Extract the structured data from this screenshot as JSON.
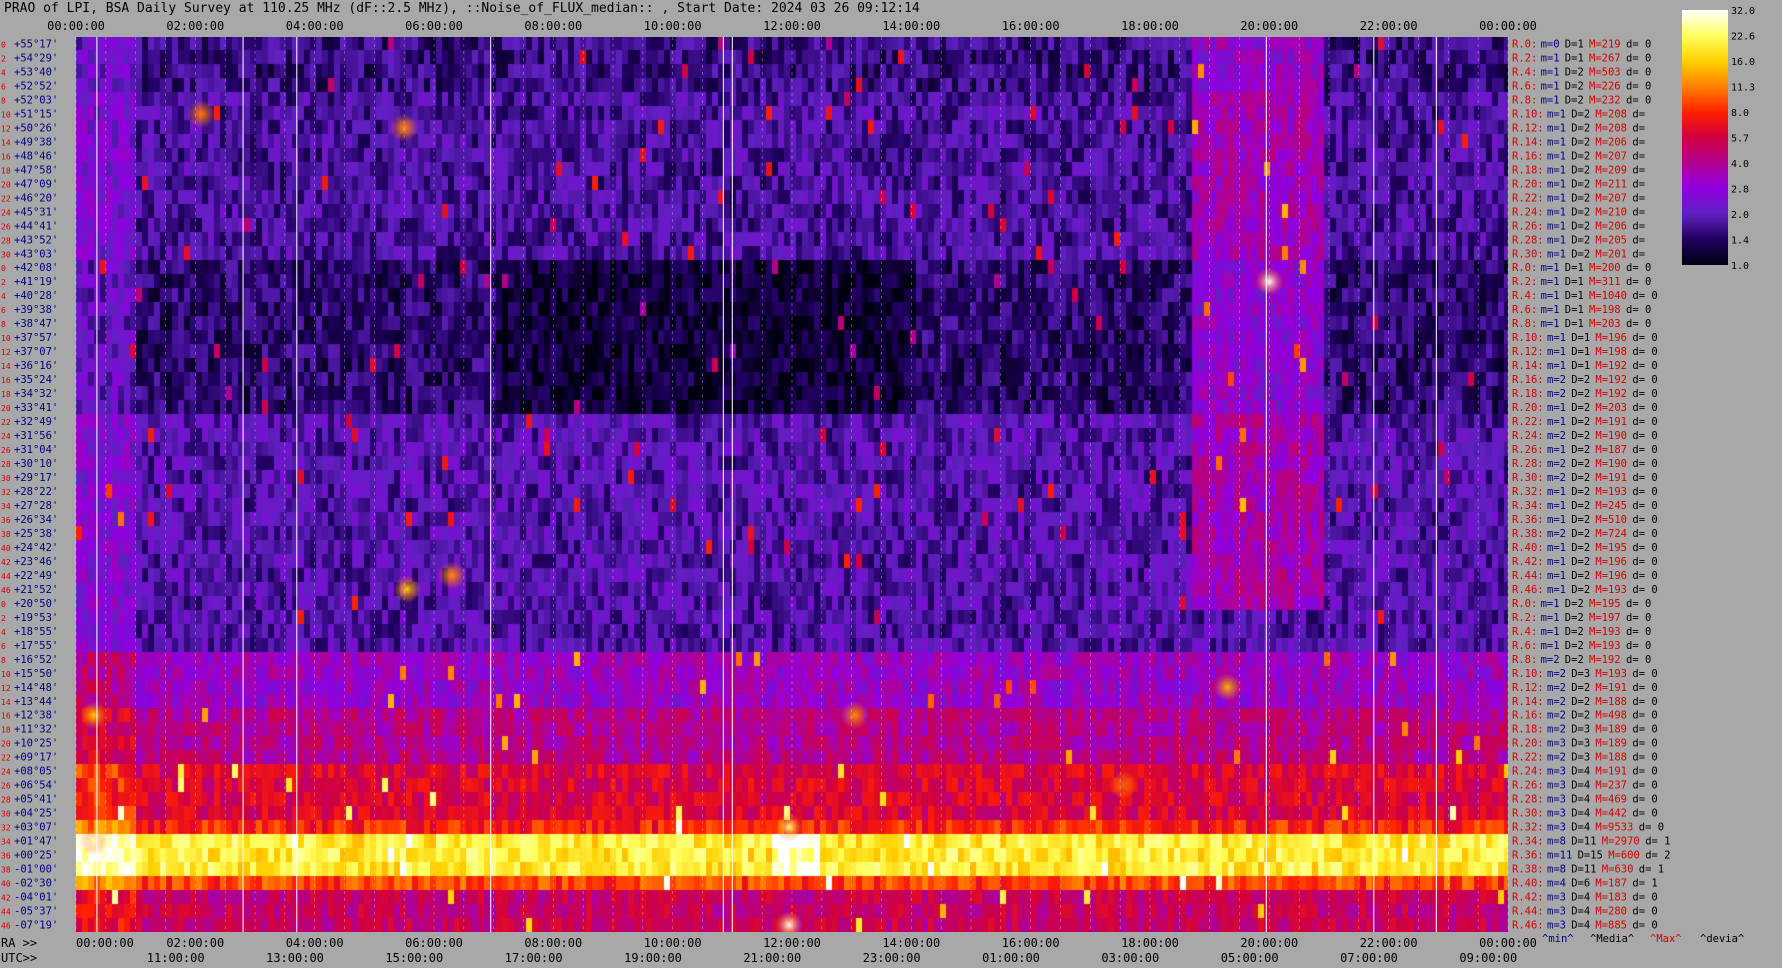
{
  "title": "PRAO of LPI, BSA Daily Survey at 110.25 MHz (dF::2.5 MHz), ::Noise_of_FLUX_median:: , Start Date: 2024 03 26 09:12:14",
  "colors": {
    "background": "#a8a8a8",
    "ray_label": "#d40000",
    "m_label": "#000080",
    "max_label": "#d40000",
    "text": "#000000"
  },
  "chart_data": {
    "type": "heatmap",
    "title": "PRAO of LPI, BSA Daily Survey at 110.25 MHz (dF::2.5 MHz), ::Noise_of_FLUX_median:: , Start Date: 2024 03 26 09:12:14",
    "top_time_ticks": [
      "00:00:00",
      "02:00:00",
      "04:00:00",
      "06:00:00",
      "08:00:00",
      "10:00:00",
      "12:00:00",
      "14:00:00",
      "16:00:00",
      "18:00:00",
      "20:00:00",
      "22:00:00",
      "00:00:00"
    ],
    "ra_prefix": "RA >>",
    "ra_ticks": [
      "00:00:00",
      "02:00:00",
      "04:00:00",
      "06:00:00",
      "08:00:00",
      "10:00:00",
      "12:00:00",
      "14:00:00",
      "16:00:00",
      "18:00:00",
      "20:00:00",
      "22:00:00",
      "00:00:00"
    ],
    "utc_prefix": "UTC>>",
    "utc_ticks": [
      "11:00:00",
      "13:00:00",
      "15:00:00",
      "17:00:00",
      "19:00:00",
      "21:00:00",
      "23:00:00",
      "01:00:00",
      "03:00:00",
      "05:00:00",
      "07:00:00",
      "09:00:00"
    ],
    "declinations": [
      "+55°17'",
      "+54°29'",
      "+53°40'",
      "+52°52'",
      "+52°03'",
      "+51°15'",
      "+50°26'",
      "+49°38'",
      "+48°46'",
      "+47°58'",
      "+47°09'",
      "+46°20'",
      "+45°31'",
      "+44°41'",
      "+43°52'",
      "+43°03'",
      "+42°08'",
      "+41°19'",
      "+40°28'",
      "+39°38'",
      "+38°47'",
      "+37°57'",
      "+37°07'",
      "+36°16'",
      "+35°24'",
      "+34°32'",
      "+33°41'",
      "+32°49'",
      "+31°56'",
      "+31°04'",
      "+30°10'",
      "+29°17'",
      "+28°22'",
      "+27°28'",
      "+26°34'",
      "+25°38'",
      "+24°42'",
      "+23°46'",
      "+22°49'",
      "+21°52'",
      "+20°50'",
      "+19°53'",
      "+18°55'",
      "+17°55'",
      "+16°52'",
      "+15°50'",
      "+14°48'",
      "+13°44'",
      "+12°38'",
      "+11°32'",
      "+10°25'",
      "+09°17'",
      "+08°05'",
      "+06°54'",
      "+05°41'",
      "+04°25'",
      "+03°07'",
      "+01°47'",
      "+00°25'",
      "-01°00'",
      "-02°30'",
      "-04°01'",
      "-05°37'",
      "-07°19'"
    ],
    "ray_numbers": [
      "0",
      "2",
      "4",
      "6",
      "8",
      "10",
      "12",
      "14",
      "16",
      "18",
      "20",
      "22",
      "24",
      "26",
      "28",
      "30",
      "0",
      "2",
      "4",
      "6",
      "8",
      "10",
      "12",
      "14",
      "16",
      "18",
      "20",
      "22",
      "24",
      "26",
      "28",
      "30",
      "32",
      "34",
      "36",
      "38",
      "40",
      "42",
      "44",
      "46",
      "0",
      "2",
      "4",
      "6",
      "8",
      "10",
      "12",
      "14",
      "16",
      "18",
      "20",
      "22",
      "24",
      "26",
      "28",
      "30",
      "32",
      "34",
      "36",
      "38",
      "40",
      "42",
      "44",
      "46"
    ],
    "rays": [
      {
        "r": "R.0:",
        "m": "m=0",
        "D": "D=1",
        "M": "M=219",
        "d": "d= 0"
      },
      {
        "r": "R.2:",
        "m": "m=1",
        "D": "D=1",
        "M": "M=267",
        "d": "d= 0"
      },
      {
        "r": "R.4:",
        "m": "m=1",
        "D": "D=2",
        "M": "M=503",
        "d": "d= 0"
      },
      {
        "r": "R.6:",
        "m": "m=1",
        "D": "D=2",
        "M": "M=226",
        "d": "d= 0"
      },
      {
        "r": "R.8:",
        "m": "m=1",
        "D": "D=2",
        "M": "M=232",
        "d": "d= 0"
      },
      {
        "r": "R.10:",
        "m": "m=1",
        "D": "D=2",
        "M": "M=208",
        "d": "d="
      },
      {
        "r": "R.12:",
        "m": "m=1",
        "D": "D=2",
        "M": "M=208",
        "d": "d="
      },
      {
        "r": "R.14:",
        "m": "m=1",
        "D": "D=2",
        "M": "M=206",
        "d": "d="
      },
      {
        "r": "R.16:",
        "m": "m=1",
        "D": "D=2",
        "M": "M=207",
        "d": "d="
      },
      {
        "r": "R.18:",
        "m": "m=1",
        "D": "D=2",
        "M": "M=209",
        "d": "d="
      },
      {
        "r": "R.20:",
        "m": "m=1",
        "D": "D=2",
        "M": "M=211",
        "d": "d="
      },
      {
        "r": "R.22:",
        "m": "m=1",
        "D": "D=2",
        "M": "M=207",
        "d": "d="
      },
      {
        "r": "R.24:",
        "m": "m=1",
        "D": "D=2",
        "M": "M=210",
        "d": "d="
      },
      {
        "r": "R.26:",
        "m": "m=1",
        "D": "D=2",
        "M": "M=206",
        "d": "d="
      },
      {
        "r": "R.28:",
        "m": "m=1",
        "D": "D=2",
        "M": "M=205",
        "d": "d="
      },
      {
        "r": "R.30:",
        "m": "m=1",
        "D": "D=2",
        "M": "M=201",
        "d": "d="
      },
      {
        "r": "R.0:",
        "m": "m=1",
        "D": "D=1",
        "M": "M=200",
        "d": "d= 0"
      },
      {
        "r": "R.2:",
        "m": "m=1",
        "D": "D=1",
        "M": "M=311",
        "d": "d= 0"
      },
      {
        "r": "R.4:",
        "m": "m=1",
        "D": "D=1",
        "M": "M=1040",
        "d": "d= 0"
      },
      {
        "r": "R.6:",
        "m": "m=1",
        "D": "D=1",
        "M": "M=198",
        "d": "d= 0"
      },
      {
        "r": "R.8:",
        "m": "m=1",
        "D": "D=1",
        "M": "M=203",
        "d": "d= 0"
      },
      {
        "r": "R.10:",
        "m": "m=1",
        "D": "D=1",
        "M": "M=196",
        "d": "d= 0"
      },
      {
        "r": "R.12:",
        "m": "m=1",
        "D": "D=1",
        "M": "M=198",
        "d": "d= 0"
      },
      {
        "r": "R.14:",
        "m": "m=1",
        "D": "D=1",
        "M": "M=192",
        "d": "d= 0"
      },
      {
        "r": "R.16:",
        "m": "m=2",
        "D": "D=2",
        "M": "M=192",
        "d": "d= 0"
      },
      {
        "r": "R.18:",
        "m": "m=2",
        "D": "D=2",
        "M": "M=192",
        "d": "d= 0"
      },
      {
        "r": "R.20:",
        "m": "m=1",
        "D": "D=2",
        "M": "M=203",
        "d": "d= 0"
      },
      {
        "r": "R.22:",
        "m": "m=1",
        "D": "D=2",
        "M": "M=191",
        "d": "d= 0"
      },
      {
        "r": "R.24:",
        "m": "m=2",
        "D": "D=2",
        "M": "M=190",
        "d": "d= 0"
      },
      {
        "r": "R.26:",
        "m": "m=1",
        "D": "D=2",
        "M": "M=187",
        "d": "d= 0"
      },
      {
        "r": "R.28:",
        "m": "m=2",
        "D": "D=2",
        "M": "M=190",
        "d": "d= 0"
      },
      {
        "r": "R.30:",
        "m": "m=2",
        "D": "D=2",
        "M": "M=191",
        "d": "d= 0"
      },
      {
        "r": "R.32:",
        "m": "m=1",
        "D": "D=2",
        "M": "M=193",
        "d": "d= 0"
      },
      {
        "r": "R.34:",
        "m": "m=1",
        "D": "D=2",
        "M": "M=245",
        "d": "d= 0"
      },
      {
        "r": "R.36:",
        "m": "m=1",
        "D": "D=2",
        "M": "M=510",
        "d": "d= 0"
      },
      {
        "r": "R.38:",
        "m": "m=2",
        "D": "D=2",
        "M": "M=724",
        "d": "d= 0"
      },
      {
        "r": "R.40:",
        "m": "m=1",
        "D": "D=2",
        "M": "M=195",
        "d": "d= 0"
      },
      {
        "r": "R.42:",
        "m": "m=1",
        "D": "D=2",
        "M": "M=196",
        "d": "d= 0"
      },
      {
        "r": "R.44:",
        "m": "m=1",
        "D": "D=2",
        "M": "M=196",
        "d": "d= 0"
      },
      {
        "r": "R.46:",
        "m": "m=1",
        "D": "D=2",
        "M": "M=193",
        "d": "d= 0"
      },
      {
        "r": "R.0:",
        "m": "m=1",
        "D": "D=2",
        "M": "M=195",
        "d": "d= 0"
      },
      {
        "r": "R.2:",
        "m": "m=1",
        "D": "D=2",
        "M": "M=197",
        "d": "d= 0"
      },
      {
        "r": "R.4:",
        "m": "m=1",
        "D": "D=2",
        "M": "M=193",
        "d": "d= 0"
      },
      {
        "r": "R.6:",
        "m": "m=1",
        "D": "D=2",
        "M": "M=193",
        "d": "d= 0"
      },
      {
        "r": "R.8:",
        "m": "m=2",
        "D": "D=2",
        "M": "M=192",
        "d": "d= 0"
      },
      {
        "r": "R.10:",
        "m": "m=2",
        "D": "D=3",
        "M": "M=193",
        "d": "d= 0"
      },
      {
        "r": "R.12:",
        "m": "m=2",
        "D": "D=2",
        "M": "M=191",
        "d": "d= 0"
      },
      {
        "r": "R.14:",
        "m": "m=2",
        "D": "D=2",
        "M": "M=188",
        "d": "d= 0"
      },
      {
        "r": "R.16:",
        "m": "m=2",
        "D": "D=2",
        "M": "M=498",
        "d": "d= 0"
      },
      {
        "r": "R.18:",
        "m": "m=2",
        "D": "D=3",
        "M": "M=189",
        "d": "d= 0"
      },
      {
        "r": "R.20:",
        "m": "m=3",
        "D": "D=3",
        "M": "M=189",
        "d": "d= 0"
      },
      {
        "r": "R.22:",
        "m": "m=2",
        "D": "D=3",
        "M": "M=188",
        "d": "d= 0"
      },
      {
        "r": "R.24:",
        "m": "m=3",
        "D": "D=4",
        "M": "M=191",
        "d": "d= 0"
      },
      {
        "r": "R.26:",
        "m": "m=3",
        "D": "D=4",
        "M": "M=237",
        "d": "d= 0"
      },
      {
        "r": "R.28:",
        "m": "m=3",
        "D": "D=4",
        "M": "M=469",
        "d": "d= 0"
      },
      {
        "r": "R.30:",
        "m": "m=3",
        "D": "D=4",
        "M": "M=442",
        "d": "d= 0"
      },
      {
        "r": "R.32:",
        "m": "m=3",
        "D": "D=4",
        "M": "M=9533",
        "d": "d= 0"
      },
      {
        "r": "R.34:",
        "m": "m=8",
        "D": "D=11",
        "M": "M=2970",
        "d": "d= 1"
      },
      {
        "r": "R.36:",
        "m": "m=11",
        "D": "D=15",
        "M": "M=600",
        "d": "d= 2"
      },
      {
        "r": "R.38:",
        "m": "m=8",
        "D": "D=11",
        "M": "M=630",
        "d": "d= 1"
      },
      {
        "r": "R.40:",
        "m": "m=4",
        "D": "D=6",
        "M": "M=187",
        "d": "d= 1"
      },
      {
        "r": "R.42:",
        "m": "m=3",
        "D": "D=4",
        "M": "M=183",
        "d": "d= 0"
      },
      {
        "r": "R.44:",
        "m": "m=3",
        "D": "D=4",
        "M": "M=280",
        "d": "d= 0"
      },
      {
        "r": "R.46:",
        "m": "m=3",
        "D": "D=4",
        "M": "M=885",
        "d": "d= 0"
      }
    ],
    "legend_keys": [
      "^min^",
      "^Media^",
      "^Max^",
      "^devia^"
    ],
    "colorbar_ticks": [
      "32.0",
      "22.6",
      "16.0",
      "11.3",
      "8.0",
      "5.7",
      "4.0",
      "2.8",
      "2.0",
      "1.4",
      "1.0"
    ],
    "colorbar_range": [
      1.0,
      32.0
    ],
    "colormap": [
      "#ffffff",
      "#ffff60",
      "#ffd000",
      "#ff8000",
      "#ff2000",
      "#d00040",
      "#b00090",
      "#9000e0",
      "#6020c0",
      "#200060",
      "#000010"
    ],
    "vertical_markers_hours": [
      0.35,
      2.8,
      3.7,
      6.95,
      10.85,
      11.0,
      19.95,
      21.75,
      22.8
    ],
    "sources": [
      {
        "hour": 20.0,
        "row": 17,
        "value": 32.0
      },
      {
        "hour": 11.95,
        "row": 63,
        "value": 32.0
      },
      {
        "hour": 11.95,
        "row": 56,
        "value": 24.0
      },
      {
        "hour": 0.3,
        "row": 57,
        "value": 28.0
      },
      {
        "hour": 0.3,
        "row": 48,
        "value": 16.0
      },
      {
        "hour": 5.55,
        "row": 39,
        "value": 16.0
      },
      {
        "hour": 6.3,
        "row": 38,
        "value": 12.0
      },
      {
        "hour": 5.5,
        "row": 6,
        "value": 12.0
      },
      {
        "hour": 13.05,
        "row": 48,
        "value": 12.0
      },
      {
        "hour": 2.1,
        "row": 5,
        "value": 11.0
      },
      {
        "hour": 17.55,
        "row": 53,
        "value": 10.0
      },
      {
        "hour": 19.3,
        "row": 46,
        "value": 14.0
      }
    ]
  }
}
